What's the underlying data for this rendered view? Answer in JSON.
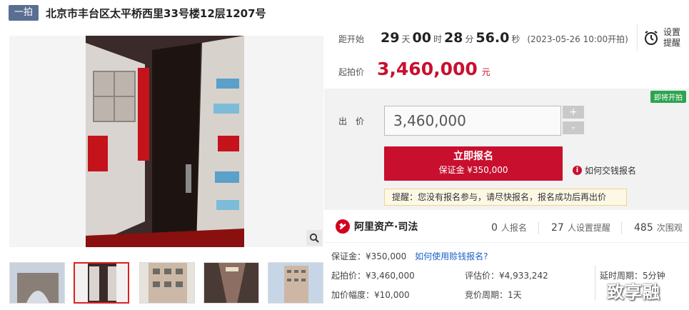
{
  "header": {
    "badge": "一拍",
    "title": "北京市丰台区太平桥西里33号楼12层1207号"
  },
  "countdown": {
    "label": "距开始",
    "days": "29",
    "days_unit": "天",
    "hours": "00",
    "hours_unit": "时",
    "minutes": "28",
    "minutes_unit": "分",
    "seconds": "56.0",
    "seconds_unit": "秒",
    "start_note": "(2023-05-26 10:00开拍)"
  },
  "reminder": {
    "line1": "设置",
    "line2": "提醒"
  },
  "start_price": {
    "label": "起拍价",
    "value": "3,460,000",
    "unit": "元"
  },
  "bid": {
    "status_badge": "即将开拍",
    "label": "出价",
    "input_value": "3,460,000",
    "plus": "+",
    "minus": "-",
    "signup_main": "立即报名",
    "signup_sub": "保证金 ¥350,000",
    "howto_label": "如何交钱报名",
    "tip": "提醒：您没有报名参与，请尽快报名，报名成功后再出价"
  },
  "brand": {
    "name": "阿里资产·司法"
  },
  "stats": [
    {
      "value": "0",
      "label": "人报名"
    },
    {
      "value": "27",
      "label": "人设置提醒"
    },
    {
      "value": "485",
      "label": "次围观"
    }
  ],
  "details": {
    "deposit": "保证金：¥350,000",
    "deposit_link": "如何使用赊钱报名?",
    "start_price": "起拍价：¥3,460,000",
    "appraisal": "评估价：¥4,933,242",
    "delay": "延时周期：5分钟",
    "increment": "加价幅度：¥10,000",
    "bid_cycle": "竞价周期：1天"
  },
  "watermark": "致享融",
  "colors": {
    "accent": "#c8102e",
    "badge": "#5a6e91",
    "soon": "#2ea44f",
    "link": "#1a5fc9"
  }
}
